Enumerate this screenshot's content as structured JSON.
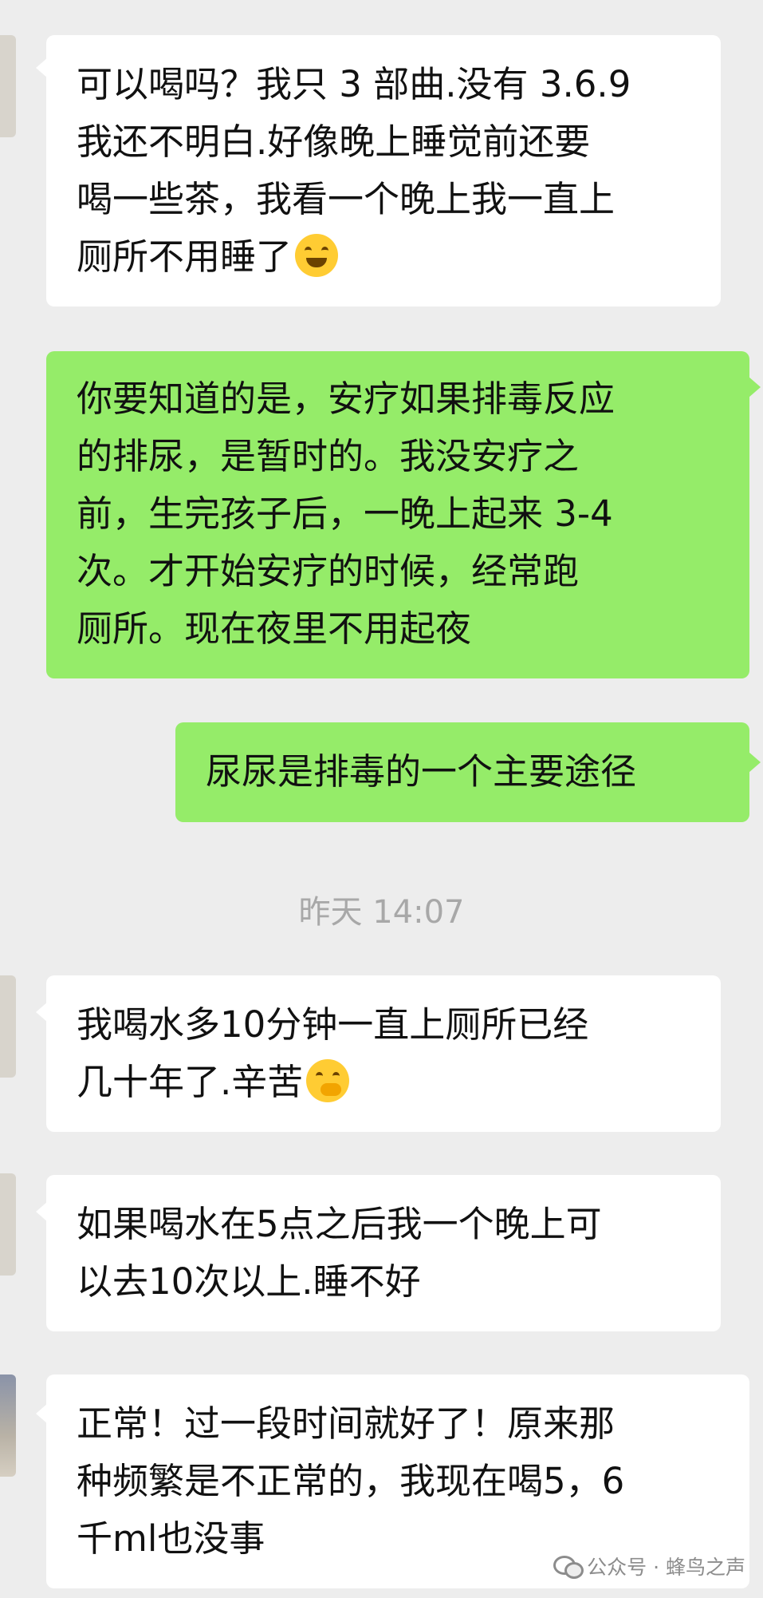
{
  "chat": {
    "messages": [
      {
        "side": "in",
        "text": "可以喝吗？我只 3 部曲.没有 3.6.9\n我还不明白.好像晚上睡觉前还要\n喝一些茶，我看一个晚上我一直上\n厕所不用睡了",
        "emoji": "rofl-emoji"
      },
      {
        "side": "out",
        "text": "你要知道的是，安疗如果排毒反应\n的排尿，是暂时的。我没安疗之\n前，生完孩子后，一晚上起来 3-4\n次。才开始安疗的时候，经常跑\n厕所。现在夜里不用起夜"
      },
      {
        "side": "out",
        "text": "尿尿是排毒的一个主要途径"
      },
      {
        "side": "in",
        "text": "我喝水多10分钟一直上厕所已经\n几十年了.辛苦",
        "emoji": "hand-over-mouth-emoji"
      },
      {
        "side": "in",
        "text": "如果喝水在5点之后我一个晚上可\n以去10次以上.睡不好"
      },
      {
        "side": "in",
        "text": "正常！过一段时间就好了！原来那\n种频繁是不正常的，我现在喝5，6\n千ml也没事"
      }
    ],
    "timestamp": "昨天 14:07"
  },
  "watermark": {
    "text": "公众号 · 蜂鸟之声",
    "icon": "wechat-icon"
  },
  "colors": {
    "background": "#ededed",
    "incoming_bubble": "#ffffff",
    "outgoing_bubble": "#95ec69",
    "timestamp_text": "#a8a8a8"
  }
}
